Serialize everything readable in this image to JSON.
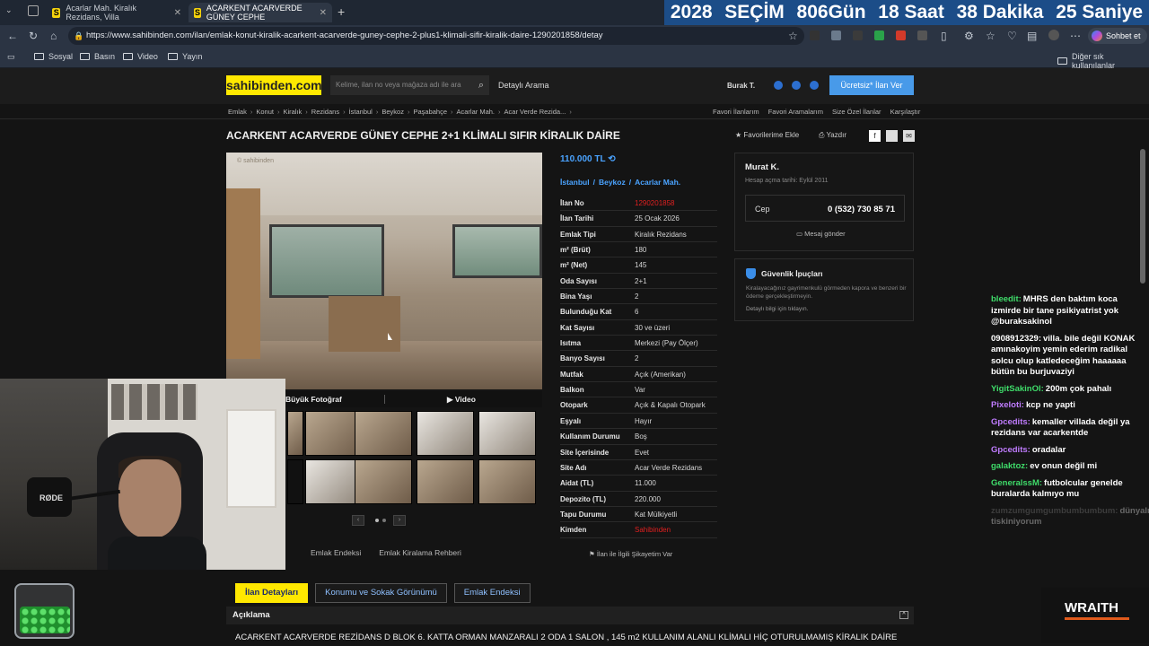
{
  "browser": {
    "tabs": [
      {
        "label": "Acarlar Mah. Kiralık Rezidans, Villa"
      },
      {
        "label": "ACARKENT ACARVERDE GÜNEY CEPHE"
      }
    ],
    "url": "https://www.sahibinden.com/ilan/emlak-konut-kiralik-acarkent-acarverde-guney-cephe-2-plus1-klimali-sifir-kiralik-daire-1290201858/detay",
    "chat_button": "Sohbet et",
    "bookmarks": [
      "Sosyal",
      "Basın",
      "Video",
      "Yayın"
    ],
    "other_bookmarks": "Diğer sık kullanılanlar"
  },
  "countdown": [
    "2028",
    "SEÇİM",
    "806Gün",
    "18 Saat",
    "38 Dakika",
    "25 Saniye"
  ],
  "site": {
    "logo": "sahibinden.com",
    "search_placeholder": "Kelime, ilan no veya mağaza adı ile ara",
    "detailed_search": "Detaylı Arama",
    "user": "Burak T.",
    "post_button": "Ücretsiz* İlan Ver",
    "breadcrumb": [
      "Emlak",
      "Konut",
      "Kiralık",
      "Rezidans",
      "İstanbul",
      "Beykoz",
      "Paşabahçe",
      "Acarlar Mah.",
      "Acar Verde Rezida..."
    ],
    "right_links": [
      "Favori İlanlarım",
      "Favori Aramalarım",
      "Size Özel İlanlar",
      "Karşılaştır"
    ]
  },
  "listing": {
    "title": "ACARKENT ACARVERDE GÜNEY CEPHE 2+1 KLİMALI SIFIR KİRALIK DAİRE",
    "add_favorite": "Favorilerime Ekle",
    "print": "Yazdır",
    "price": "110.000 TL",
    "location": [
      "İstanbul",
      "Beykoz",
      "Acarlar Mah."
    ],
    "photo_watermark": "© sahibinden",
    "big_photo": "Büyük Fotoğraf",
    "video": "Video",
    "under_links": [
      "Emlak Endeksi",
      "Emlak Kiralama Rehberi"
    ],
    "complaint": "İlan ile İlgili Şikayetim Var",
    "details": [
      {
        "label": "İlan No",
        "value": "1290201858",
        "red": true
      },
      {
        "label": "İlan Tarihi",
        "value": "25 Ocak 2026"
      },
      {
        "label": "Emlak Tipi",
        "value": "Kiralık Rezidans"
      },
      {
        "label": "m² (Brüt)",
        "value": "180"
      },
      {
        "label": "m² (Net)",
        "value": "145"
      },
      {
        "label": "Oda Sayısı",
        "value": "2+1"
      },
      {
        "label": "Bina Yaşı",
        "value": "2"
      },
      {
        "label": "Bulunduğu Kat",
        "value": "6"
      },
      {
        "label": "Kat Sayısı",
        "value": "30 ve üzeri"
      },
      {
        "label": "Isıtma",
        "value": "Merkezi (Pay Ölçer)"
      },
      {
        "label": "Banyo Sayısı",
        "value": "2"
      },
      {
        "label": "Mutfak",
        "value": "Açık (Amerikan)"
      },
      {
        "label": "Balkon",
        "value": "Var"
      },
      {
        "label": "Otopark",
        "value": "Açık & Kapalı Otopark"
      },
      {
        "label": "Eşyalı",
        "value": "Hayır"
      },
      {
        "label": "Kullanım Durumu",
        "value": "Boş"
      },
      {
        "label": "Site İçerisinde",
        "value": "Evet"
      },
      {
        "label": "Site Adı",
        "value": "Acar Verde Rezidans"
      },
      {
        "label": "Aidat (TL)",
        "value": "11.000"
      },
      {
        "label": "Depozito (TL)",
        "value": "220.000"
      },
      {
        "label": "Tapu Durumu",
        "value": "Kat Mülkiyetli"
      },
      {
        "label": "Kimden",
        "value": "Sahibinden",
        "red": true
      }
    ]
  },
  "seller": {
    "name": "Murat K.",
    "since": "Hesap açma tarihi: Eylül 2011",
    "phone_label": "Cep",
    "phone": "0 (532) 730 85 71",
    "message": "Mesaj gönder"
  },
  "safety": {
    "title": "Güvenlik İpuçları",
    "text": "Kiralayacağınız gayrimenkulü görmeden kapora ve benzeri bir ödeme gerçekleştirmeyin.",
    "more": "Detaylı bilgi için tıklayın."
  },
  "bottom_tabs": [
    "İlan Detayları",
    "Konumu ve Sokak Görünümü",
    "Emlak Endeksi"
  ],
  "description": {
    "heading": "Açıklama",
    "text": "ACARKENT ACARVERDE REZİDANS D BLOK 6. KATTA ORMAN MANZARALI 2 ODA 1 SALON , 145 m2 KULLANIM ALANLI KLİMALI HİÇ OTURULMAMIŞ KİRALIK DAİRE"
  },
  "stream": {
    "mic_brand": "RØDE",
    "wraith": "WRAITH",
    "chat": [
      {
        "user": "bleedit:",
        "color": "#3fdc6a",
        "text": "MHRS den baktım koca izmirde bir tane psikiyatrist yok @buraksakinol"
      },
      {
        "user": "0908912329:",
        "color": "#ffffff",
        "text": "villa. bile değil KONAK amınakoyim yemin ederim radikal solcu olup katledeceğim haaaaaa bütün bu burjuvaziyi"
      },
      {
        "user": "YigitSakinOl:",
        "color": "#3fdc6a",
        "text": "200m çok pahalı"
      },
      {
        "user": "Pixeloti:",
        "color": "#c07cff",
        "text": "kcp ne yapti"
      },
      {
        "user": "Gpcedits:",
        "color": "#c07cff",
        "text": "kemaller villada değil ya rezidans var acarkentde"
      },
      {
        "user": "Gpcedits:",
        "color": "#c07cff",
        "text": "oradalar"
      },
      {
        "user": "galaktoz:",
        "color": "#3fdc6a",
        "text": "ev onun değil mi"
      },
      {
        "user": "GeneralssM:",
        "color": "#3fdc6a",
        "text": "futbolcular genelde buralarda kalmıyo mu"
      },
      {
        "user": "zumzumgumgumbumbumbum:",
        "color": "#888888",
        "text": "dünyalılardan tiskiniyorum",
        "faded": true
      }
    ]
  }
}
